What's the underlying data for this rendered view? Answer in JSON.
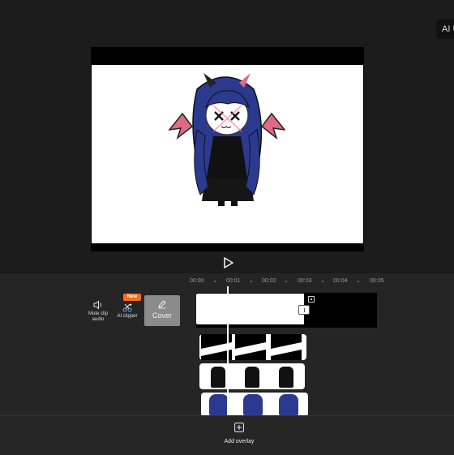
{
  "topbar": {
    "ai_chip_label": "AI U"
  },
  "preview": {
    "canvas_color": "#ffffff",
    "letterbox_color": "#000000",
    "character_image": "chibi-demon-girl-illustration"
  },
  "controls": {
    "play_icon": "play-icon"
  },
  "timeline": {
    "ruler": [
      "00:00",
      "00:01",
      "00:02",
      "00:03",
      "00:04",
      "00:05"
    ],
    "tools": [
      {
        "label": "Mute clip audio",
        "icon": "speaker-icon"
      },
      {
        "label": "AI clipper",
        "icon": "scissors-sparkle-icon",
        "badge": "New"
      }
    ],
    "cover_label": "Cover",
    "overlay_tracks": 3
  },
  "bottom": {
    "add_overlay_label": "Add overlay",
    "add_overlay_icon": "plus-square-icon"
  },
  "colors": {
    "badge": "#ff6a1a",
    "background": "#1c1c1c",
    "timeline_bg": "#252525"
  }
}
